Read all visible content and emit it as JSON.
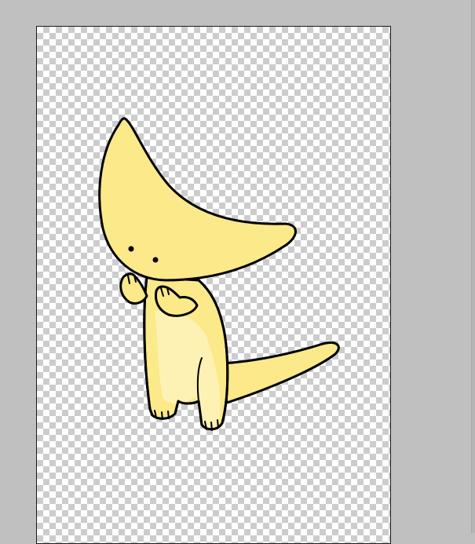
{
  "app": {
    "workspace_color": "#c0c0c0",
    "transparency_grid_colors": [
      "#ffffff",
      "#cccccc"
    ]
  },
  "artwork": {
    "subject_icon": "yellow-crescent-creature",
    "fill_color": "#fbe98a",
    "belly_color": "#fdf2b4",
    "outline_color": "#000000"
  }
}
